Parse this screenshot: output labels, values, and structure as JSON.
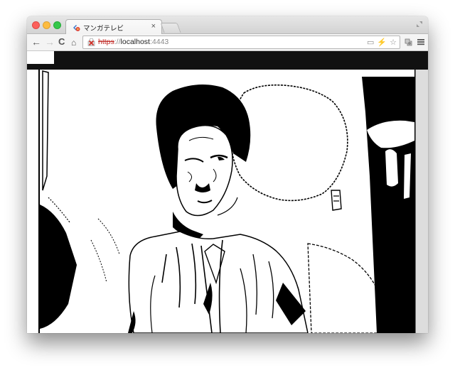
{
  "browser": {
    "tab": {
      "title": "マンガテレビ",
      "close_glyph": "×",
      "favicon": "manga-tv-favicon"
    },
    "toolbar": {
      "back_glyph": "←",
      "forward_glyph": "→",
      "reload_glyph": "C",
      "home_glyph": "⌂"
    },
    "address": {
      "scheme": "https",
      "separator": "://",
      "host": "localhost",
      "port": ":4443",
      "security": "ssl-error-icon"
    },
    "omnibox_icons": {
      "camera": "▭",
      "plugin": "⚡",
      "star": "☆"
    }
  },
  "page": {
    "content": "monochrome-webcam-feed",
    "colors": {
      "ink": "#000000",
      "paper": "#ffffff",
      "bar": "#111111"
    }
  }
}
